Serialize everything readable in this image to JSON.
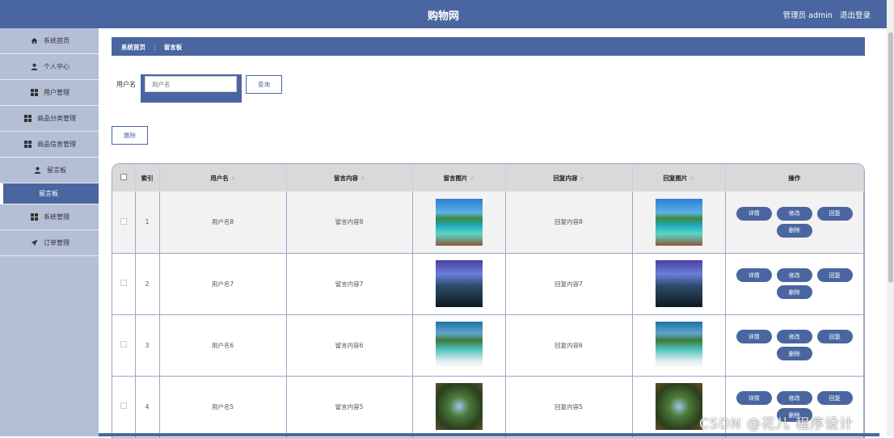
{
  "header": {
    "title": "购物网",
    "admin_label": "管理员 admin",
    "logout": "退出登录"
  },
  "sidebar": {
    "items": [
      {
        "label": "系统首页",
        "icon": "home-icon"
      },
      {
        "label": "个人中心",
        "icon": "user-icon"
      },
      {
        "label": "用户管理",
        "icon": "grid-icon"
      },
      {
        "label": "商品分类管理",
        "icon": "grid-icon"
      },
      {
        "label": "商品信息管理",
        "icon": "grid-icon"
      },
      {
        "label": "留言板",
        "icon": "user-icon"
      },
      {
        "label": "留言板",
        "icon": "",
        "active": true
      },
      {
        "label": "系统管理",
        "icon": "grid-icon"
      },
      {
        "label": "订单管理",
        "icon": "send-icon"
      }
    ]
  },
  "breadcrumb": {
    "home": "系统首页",
    "separator": "⋮",
    "current": "留言板"
  },
  "search": {
    "label": "用户名",
    "placeholder": "用户名",
    "query_button": "查询"
  },
  "toolbar": {
    "delete_button": "删除"
  },
  "table": {
    "headers": [
      "索引",
      "用户名",
      "留言内容",
      "留言图片",
      "回复内容",
      "回复图片",
      "操作"
    ],
    "rows": [
      {
        "index": "1",
        "username": "用户名8",
        "content": "留言内容8",
        "reply": "回复内容8"
      },
      {
        "index": "2",
        "username": "用户名7",
        "content": "留言内容7",
        "reply": "回复内容7"
      },
      {
        "index": "3",
        "username": "用户名6",
        "content": "留言内容6",
        "reply": "回复内容6"
      },
      {
        "index": "4",
        "username": "用户名5",
        "content": "留言内容5",
        "reply": "回复内容5"
      }
    ],
    "actions": {
      "detail": "详情",
      "edit": "修改",
      "reply": "回复",
      "delete": "删除"
    }
  },
  "watermark": "CSDN @花儿 程序设计",
  "colors": {
    "primary": "#4a66a0",
    "sidebar_bg": "#b4bfd6"
  }
}
